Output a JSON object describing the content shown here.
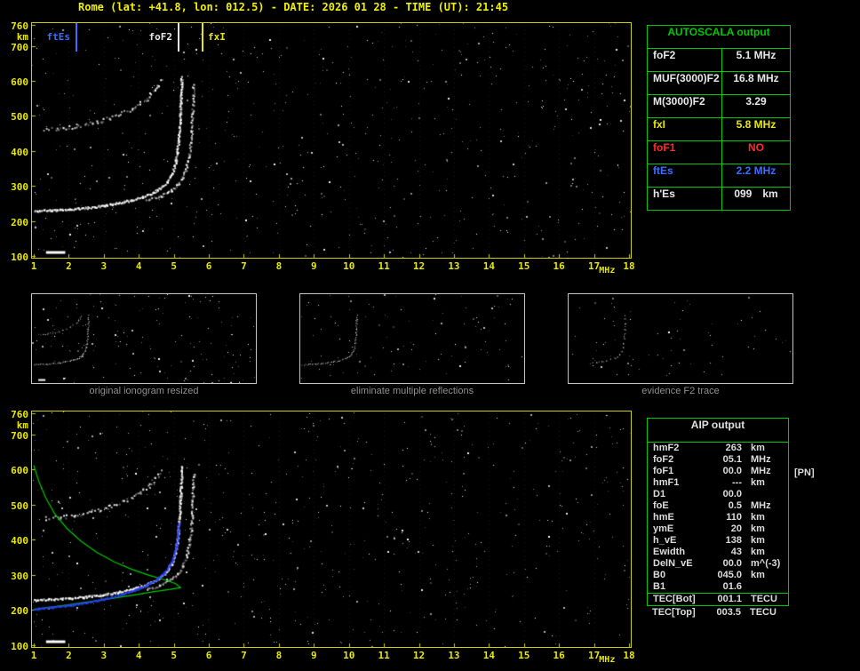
{
  "title": "Rome (lat: +41.8, lon: 012.5) - DATE: 2026 01 28 - TIME (UT): 21:45",
  "colors": {
    "yellow": "#e8e800",
    "green": "#00c800",
    "white": "#e8e8e8",
    "red": "#ff2a2a",
    "blue": "#3b6eff",
    "blue_trace": "#2840ff",
    "gray": "#8f8f8f",
    "plot_border": "#cfcf00"
  },
  "axes": {
    "y_ticks": [
      760,
      700,
      600,
      500,
      400,
      300,
      200,
      100
    ],
    "y_unit": "km",
    "x_ticks": [
      1,
      2,
      3,
      4,
      5,
      6,
      7,
      8,
      9,
      10,
      11,
      12,
      13,
      14,
      15,
      16,
      17,
      18
    ],
    "x_unit": "MHz"
  },
  "annotations": [
    {
      "label": "ftEs",
      "freq": 2.2,
      "color_key": "blue",
      "side": "left"
    },
    {
      "label": "foF2",
      "freq": 5.1,
      "color_key": "white",
      "side": "left"
    },
    {
      "label": "fxI",
      "freq": 5.8,
      "color_key": "yellow",
      "side": "right"
    }
  ],
  "autoscala": {
    "header": "AUTOSCALA output",
    "rows": [
      {
        "label": "foF2",
        "value": "5.1 MHz",
        "color_key": "white"
      },
      {
        "label": "MUF(3000)F2",
        "value": "16.8 MHz",
        "color_key": "white"
      },
      {
        "label": "M(3000)F2",
        "value": "3.29",
        "color_key": "white"
      },
      {
        "label": "fxI",
        "value": "5.8 MHz",
        "color_key": "yellow"
      },
      {
        "label": "foF1",
        "value": "NO",
        "color_key": "red"
      },
      {
        "label": "ftEs",
        "value": "2.2 MHz",
        "color_key": "blue"
      },
      {
        "label": "h'Es",
        "value": "099",
        "unit": "km",
        "color_key": "white"
      }
    ]
  },
  "aip": {
    "header": "AIP output",
    "rows": [
      {
        "name": "hmF2",
        "value": "263",
        "unit": "km"
      },
      {
        "name": "foF2",
        "value": "05.1",
        "unit": "MHz"
      },
      {
        "name": "foF1",
        "value": "00.0",
        "unit": "MHz"
      },
      {
        "name": "hmF1",
        "value": "---",
        "unit": "km"
      },
      {
        "name": "D1",
        "value": "00.0",
        "unit": ""
      },
      {
        "name": "foE",
        "value": "0.5",
        "unit": "MHz"
      },
      {
        "name": "hmE",
        "value": "110",
        "unit": "km"
      },
      {
        "name": "ymE",
        "value": "20",
        "unit": "km"
      },
      {
        "name": "h_vE",
        "value": "138",
        "unit": "km"
      },
      {
        "name": "Ewidth",
        "value": "43",
        "unit": "km"
      },
      {
        "name": "DelN_vE",
        "value": "00.0",
        "unit": "m^(-3)"
      },
      {
        "name": "B0",
        "value": "045.0",
        "unit": "km"
      },
      {
        "name": "B1",
        "value": "01.6",
        "unit": ""
      },
      {
        "name": "TEC[Bot]",
        "value": "001.1",
        "unit": "TECU",
        "sep": true
      }
    ],
    "tec_top": {
      "name": "TEC[Top]",
      "value": "003.5",
      "unit": "TECU"
    },
    "pn_note": "[PN]"
  },
  "thumbnails": [
    {
      "caption": "original ionogram resized"
    },
    {
      "caption": "eliminate multiple reflections"
    },
    {
      "caption": "evidence F2 trace"
    }
  ],
  "chart_data": {
    "type": "scatter",
    "title": "Ionogram, Rome, 2026-01-28 21:45 UT",
    "xlabel": "MHz",
    "ylabel": "km",
    "xlim": [
      1,
      18
    ],
    "ylim": [
      100,
      760
    ],
    "traces": {
      "f2_ordinary": [
        [
          1.0,
          230
        ],
        [
          1.5,
          232
        ],
        [
          2.0,
          235
        ],
        [
          2.5,
          239
        ],
        [
          3.0,
          245
        ],
        [
          3.4,
          252
        ],
        [
          3.8,
          261
        ],
        [
          4.1,
          270
        ],
        [
          4.4,
          282
        ],
        [
          4.6,
          295
        ],
        [
          4.8,
          313
        ],
        [
          4.93,
          335
        ],
        [
          5.02,
          362
        ],
        [
          5.08,
          395
        ],
        [
          5.12,
          430
        ],
        [
          5.15,
          468
        ],
        [
          5.17,
          505
        ],
        [
          5.19,
          545
        ],
        [
          5.2,
          582
        ],
        [
          5.21,
          612
        ]
      ],
      "f2_extraordinary": [
        [
          4.2,
          260
        ],
        [
          4.6,
          272
        ],
        [
          4.9,
          288
        ],
        [
          5.1,
          306
        ],
        [
          5.25,
          328
        ],
        [
          5.35,
          355
        ],
        [
          5.42,
          390
        ],
        [
          5.47,
          428
        ],
        [
          5.5,
          468
        ],
        [
          5.52,
          510
        ],
        [
          5.54,
          552
        ],
        [
          5.55,
          588
        ]
      ],
      "second_hop": [
        [
          1.3,
          462
        ],
        [
          1.7,
          466
        ],
        [
          2.1,
          471
        ],
        [
          2.5,
          478
        ],
        [
          2.9,
          487
        ],
        [
          3.2,
          497
        ],
        [
          3.5,
          509
        ],
        [
          3.8,
          523
        ],
        [
          4.05,
          538
        ],
        [
          4.25,
          554
        ],
        [
          4.4,
          570
        ],
        [
          4.52,
          586
        ],
        [
          4.6,
          600
        ]
      ],
      "es": [
        [
          1.35,
          110
        ],
        [
          1.9,
          110
        ]
      ],
      "restored_blue": [
        [
          1.0,
          204
        ],
        [
          1.5,
          209
        ],
        [
          2.0,
          215
        ],
        [
          2.5,
          223
        ],
        [
          3.0,
          233
        ],
        [
          3.5,
          246
        ],
        [
          3.9,
          259
        ],
        [
          4.2,
          272
        ],
        [
          4.5,
          289
        ],
        [
          4.7,
          305
        ],
        [
          4.85,
          324
        ],
        [
          4.97,
          348
        ],
        [
          5.05,
          378
        ],
        [
          5.1,
          412
        ],
        [
          5.13,
          448
        ]
      ],
      "profile_topside_green": [
        [
          1.0,
          612
        ],
        [
          1.15,
          565
        ],
        [
          1.35,
          518
        ],
        [
          1.6,
          474
        ],
        [
          1.95,
          432
        ],
        [
          2.35,
          396
        ],
        [
          2.8,
          364
        ],
        [
          3.3,
          337
        ],
        [
          3.8,
          316
        ],
        [
          4.3,
          299
        ],
        [
          4.75,
          286
        ],
        [
          5.05,
          275
        ],
        [
          5.2,
          263
        ]
      ],
      "profile_bottom_green": [
        [
          1.0,
          202
        ],
        [
          1.7,
          211
        ],
        [
          2.4,
          221
        ],
        [
          3.1,
          231
        ],
        [
          3.8,
          242
        ],
        [
          4.4,
          252
        ],
        [
          4.9,
          259
        ],
        [
          5.2,
          264
        ]
      ]
    },
    "noise_counts": {
      "top": 650,
      "bottom": 650,
      "thumbs": [
        160,
        110,
        70
      ]
    }
  }
}
